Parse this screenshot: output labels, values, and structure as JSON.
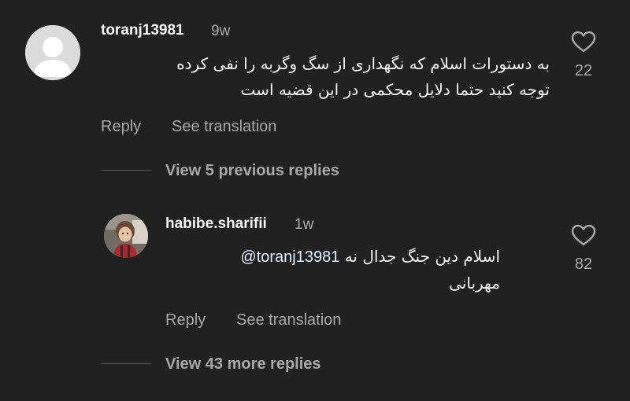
{
  "comments": [
    {
      "username": "toranj13981",
      "time": "9w",
      "text_lines": [
        "به دستورات اسلام که نگهداری از سگ وگربه را  نفی کرده",
        "توجه کنید حتما دلایل محکمی در این قضیه است"
      ],
      "reply_label": "Reply",
      "translate_label": "See translation",
      "like_count": "22",
      "view_replies_label": "View 5 previous replies"
    },
    {
      "username": "habibe.sharifii",
      "time": "1w",
      "mention": "@toranj13981",
      "text_line1": "اسلام دین جنگ جدال نه",
      "text_line2": "مهربانی",
      "reply_label": "Reply",
      "translate_label": "See translation",
      "like_count": "82",
      "view_replies_label": "View 43 more replies"
    }
  ],
  "colors": {
    "background": "#212121",
    "primary_text": "#f5f5f5",
    "secondary_text": "#a8a8a8"
  },
  "icons": {
    "like": "heart-outline-icon",
    "default_avatar": "person-silhouette"
  }
}
